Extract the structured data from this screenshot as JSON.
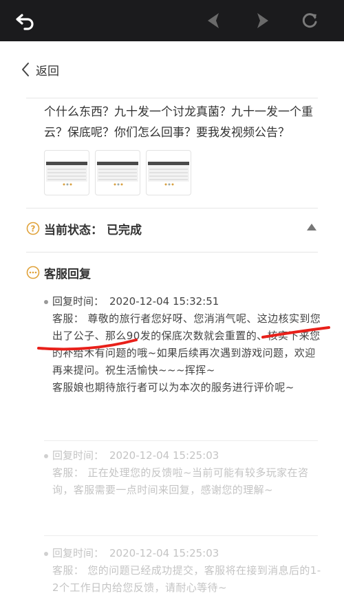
{
  "nav": {
    "back_label": "返回"
  },
  "question": {
    "text": "个什么东西？九十发一个讨龙真菌？九十一发一个重云？保底呢？你们怎么回事？要我发视频公告？"
  },
  "status": {
    "label": "当前状态：",
    "value": "已完成"
  },
  "replies_section": {
    "title": "客服回复"
  },
  "replies": [
    {
      "time_label": "回复时间：",
      "time": "2020-12-04 15:32:51",
      "body": "客服：  尊敬的旅行者您好呀、您消消气呢、这边核实到您出了公子、那么90发的保底次数就会重置的、核实下来您的补给木有问题的哦~如果后续再次遇到游戏问题，欢迎再来提问。祝生活愉快~~~挥挥~",
      "body2": "客服娘也期待旅行者可以为本次的服务进行评价呢~"
    },
    {
      "time_label": "回复时间：",
      "time": "2020-12-04 15:25:03",
      "body": "客服：  正在处理您的反馈啦~当前可能有较多玩家在咨询，客服需要一点时间来回复，感谢您的理解~"
    },
    {
      "time_label": "回复时间：",
      "time": "2020-12-04 15:25:03",
      "body": "客服：  您的问题已经成功提交，客服将在接到消息后的1-2个工作日内给您反馈，请耐心等待~"
    }
  ],
  "colors": {
    "topbar": "#1b1b1d",
    "help_icon": "#e0a23a",
    "annotation": "#e8201a"
  }
}
